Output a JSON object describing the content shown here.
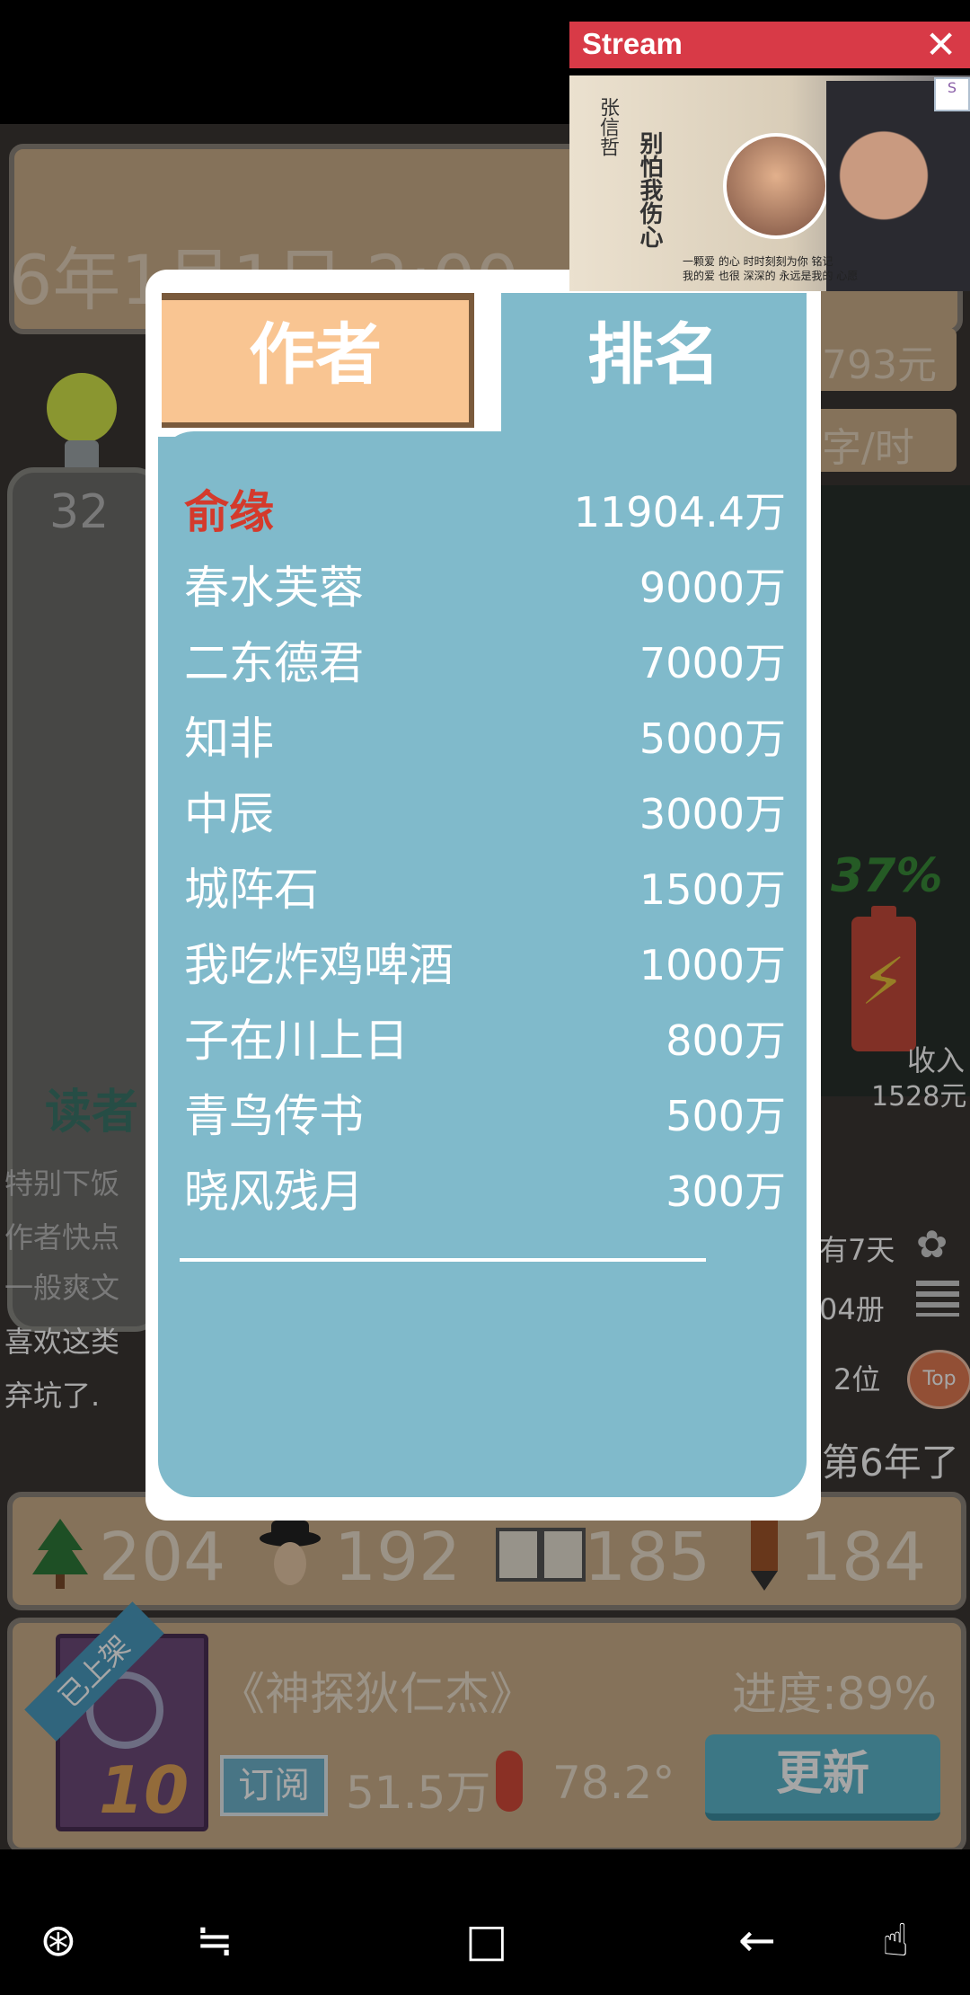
{
  "stream": {
    "title": "Stream",
    "close": "✕",
    "poster_artist": "张信哲",
    "poster_song": "别怕我伤心",
    "poster_caption_1": "一颗爱 的心 时时刻刻为你 铭记",
    "poster_caption_2": "我的爱 也很 深深的 永远是我的 心愿"
  },
  "background": {
    "date": "6年1月1日  2:00",
    "money": "793元",
    "speed": "字/时",
    "count": "32",
    "percent": "37%",
    "income_label": "收入",
    "income_value": "1528元",
    "reader_label": "读者",
    "comments": [
      "特别下饭",
      "作者快点",
      "一般爽文",
      "喜欢这类",
      "弃坑了."
    ],
    "days_text": "有7天",
    "books_text": "04册",
    "rank_text": "2位",
    "top_label": "Top",
    "year_text": "第6年了"
  },
  "stats": [
    {
      "icon": "tree-icon",
      "value": "204"
    },
    {
      "icon": "detective-icon",
      "value": "192"
    },
    {
      "icon": "book-open-icon",
      "value": "185"
    },
    {
      "icon": "pencil-icon",
      "value": "184"
    }
  ],
  "book": {
    "ribbon": "已上架",
    "issue": "10",
    "title": "《神探狄仁杰》",
    "progress": "进度:89%",
    "subscribe_label": "订阅",
    "subscribers": "51.5万",
    "temperature": "78.2°",
    "update_label": "更新"
  },
  "dialog": {
    "tab_author": "作者",
    "tab_rank": "排名",
    "rows": [
      {
        "name": "俞缘",
        "value": "11904.4万",
        "highlight": true
      },
      {
        "name": "春水芙蓉",
        "value": "9000万"
      },
      {
        "name": "二东德君",
        "value": "7000万"
      },
      {
        "name": "知非",
        "value": "5000万"
      },
      {
        "name": "中辰",
        "value": "3000万"
      },
      {
        "name": "城阵石",
        "value": "1500万"
      },
      {
        "name": "我吃炸鸡啤酒",
        "value": "1000万"
      },
      {
        "name": "子在川上日",
        "value": "800万"
      },
      {
        "name": "青鸟传书",
        "value": "500万"
      },
      {
        "name": "晓风残月",
        "value": "300万"
      }
    ]
  },
  "nav": {
    "game": "⊛",
    "recents": "≒",
    "home": "□",
    "back": "←",
    "touch": "☝"
  },
  "colors": {
    "accent_tab": "#f9c592",
    "panel_blue": "#80bacb",
    "highlight": "#d43a2c",
    "stream_red": "#d83a47"
  }
}
